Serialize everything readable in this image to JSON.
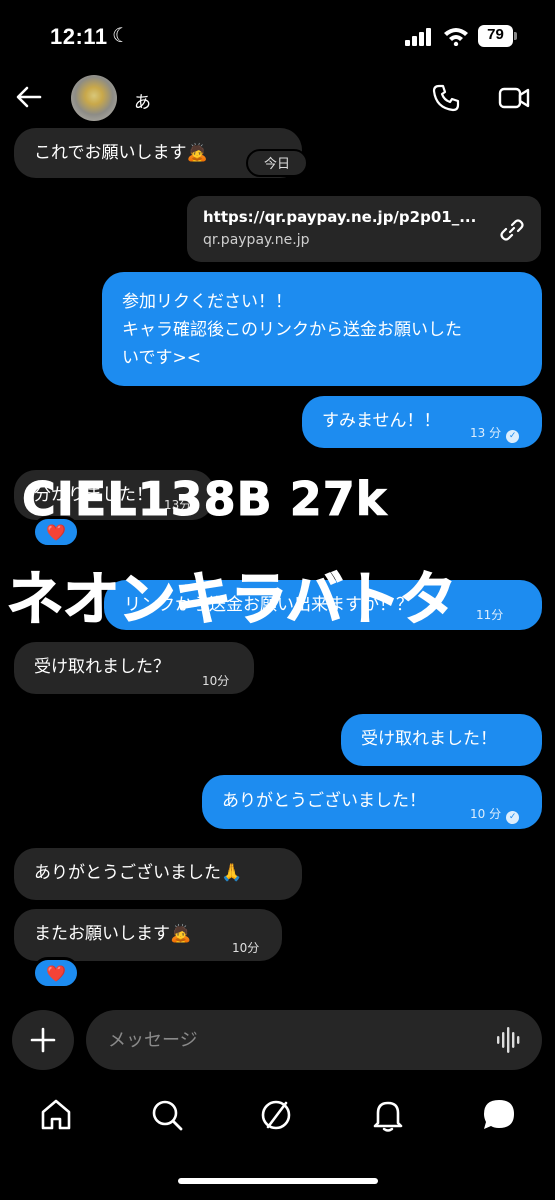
{
  "status_bar": {
    "time": "12:11",
    "battery": "79"
  },
  "header": {
    "contact_name": "あ"
  },
  "messages": {
    "m1": {
      "text": "これでお願いします🙇"
    },
    "today_label": "今日",
    "link": {
      "url": "https://qr.paypay.ne.jp/p2p01_...",
      "domain": "qr.paypay.ne.jp"
    },
    "m2": {
      "line1": "参加リクください！！",
      "line2": "キャラ確認後このリンクから送金お願いした",
      "line3": "いです><"
    },
    "m3": {
      "text": "すみません！！",
      "time": "13 分"
    },
    "m4": {
      "text": "分かりました！",
      "time": "13分"
    },
    "m5": {
      "text": "リンクから送金お願い出来ますか！？",
      "time": "11分"
    },
    "m6": {
      "text": "受け取れました？",
      "time": "10分"
    },
    "m7": {
      "text": "受け取れました！"
    },
    "m8": {
      "text": "ありがとうございました！",
      "time": "10 分"
    },
    "m9": {
      "text": "ありがとうございました🙏"
    },
    "m10": {
      "text": "またお願いします🙇",
      "time": "10分"
    },
    "reaction": "❤️"
  },
  "overlay": {
    "line1": "CIEL138B 27k",
    "line2": "ネオンキラバトタ"
  },
  "composer": {
    "placeholder": "メッセージ"
  },
  "tabs": [
    "home",
    "search",
    "explore",
    "notifications",
    "messages"
  ]
}
